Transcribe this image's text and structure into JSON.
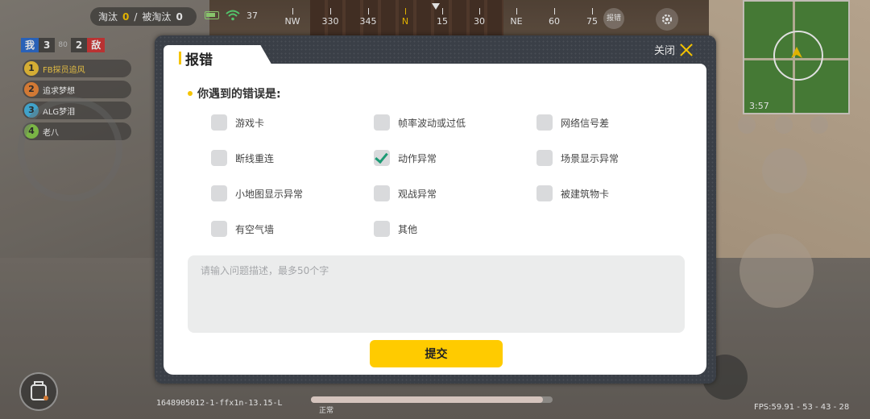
{
  "hud": {
    "eliminations_label": "淘汰",
    "eliminations_value": "0",
    "divider": "/",
    "eliminated_by_label": "被淘汰",
    "eliminated_by_value": "0",
    "signal_value": "37",
    "compass": [
      "NW",
      "330",
      "345",
      "N",
      "15",
      "30",
      "NE",
      "60",
      "75"
    ],
    "report_chip_label": "报错"
  },
  "team": {
    "me_label": "我",
    "me_score": "3",
    "total": "80",
    "enemy_score": "2",
    "enemy_label": "敌",
    "members": [
      {
        "index": "1",
        "name": "FB探员追风",
        "color": "#f3c53c"
      },
      {
        "index": "2",
        "name": "追求梦想",
        "color": "#f08a3c"
      },
      {
        "index": "3",
        "name": "ALG梦泪",
        "color": "#49b9e6"
      },
      {
        "index": "4",
        "name": "老八",
        "color": "#8bcf4f"
      }
    ]
  },
  "minimap": {
    "timer": "3:57"
  },
  "footer": {
    "build_id": "1648905012-1-ffx1n-13.15-L",
    "fps": "FPS:59.91 - 53 - 43 - 28",
    "hp_state": "正常",
    "hp_level": 0.96
  },
  "dialog": {
    "title": "报错",
    "close_label": "关闭",
    "question": "你遇到的错误是:",
    "options": [
      {
        "label": "游戏卡",
        "checked": false
      },
      {
        "label": "帧率波动或过低",
        "checked": false
      },
      {
        "label": "网络信号差",
        "checked": false
      },
      {
        "label": "断线重连",
        "checked": false
      },
      {
        "label": "动作异常",
        "checked": true
      },
      {
        "label": "场景显示异常",
        "checked": false
      },
      {
        "label": "小地图显示异常",
        "checked": false
      },
      {
        "label": "观战异常",
        "checked": false
      },
      {
        "label": "被建筑物卡",
        "checked": false
      },
      {
        "label": "有空气墙",
        "checked": false
      },
      {
        "label": "其他",
        "checked": false
      }
    ],
    "description_placeholder": "请输入问题描述，最多50个字",
    "description_value": "",
    "submit_label": "提交"
  }
}
